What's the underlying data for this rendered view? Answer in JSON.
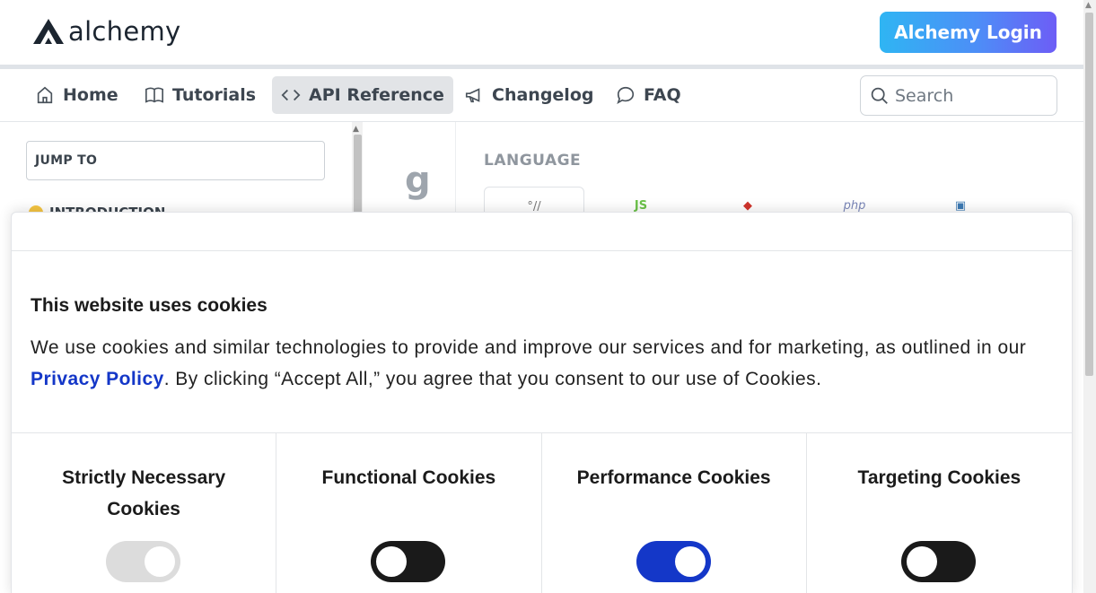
{
  "header": {
    "logo_text": "alchemy",
    "login_label": "Alchemy Login"
  },
  "nav": {
    "items": [
      {
        "label": "Home",
        "icon": "home-icon"
      },
      {
        "label": "Tutorials",
        "icon": "book-icon"
      },
      {
        "label": "API Reference",
        "icon": "code-icon",
        "active": true
      },
      {
        "label": "Changelog",
        "icon": "megaphone-icon"
      },
      {
        "label": "FAQ",
        "icon": "chat-bubble-icon"
      }
    ],
    "search_placeholder": "Search"
  },
  "sidebar": {
    "jump_to": "JUMP TO",
    "intro_label": "INTRODUCTION"
  },
  "main": {
    "g_char": "g",
    "language_label": "LANGUAGE",
    "languages": [
      {
        "name": "shell",
        "glyph": "°//"
      },
      {
        "name": "node",
        "glyph": "JS"
      },
      {
        "name": "ruby",
        "glyph": "◆"
      },
      {
        "name": "php",
        "glyph": "php"
      },
      {
        "name": "python",
        "glyph": "▣"
      }
    ]
  },
  "cookie": {
    "title": "This website uses cookies",
    "text_before": "We use cookies and similar technologies to provide and improve our services and for marketing, as outlined in our ",
    "policy_link": "Privacy Policy",
    "text_after": ". By clicking “Accept All,” you agree that you consent to our use of Cookies.",
    "categories": [
      {
        "label": "Strictly Necessary Cookies",
        "state": "disabled"
      },
      {
        "label": "Functional Cookies",
        "state": "off"
      },
      {
        "label": "Performance Cookies",
        "state": "on"
      },
      {
        "label": "Targeting Cookies",
        "state": "off"
      }
    ]
  },
  "colors": {
    "accent_blue": "#1437c8",
    "login_gradient_start": "#2fb5f3",
    "login_gradient_end": "#6d5df6"
  }
}
